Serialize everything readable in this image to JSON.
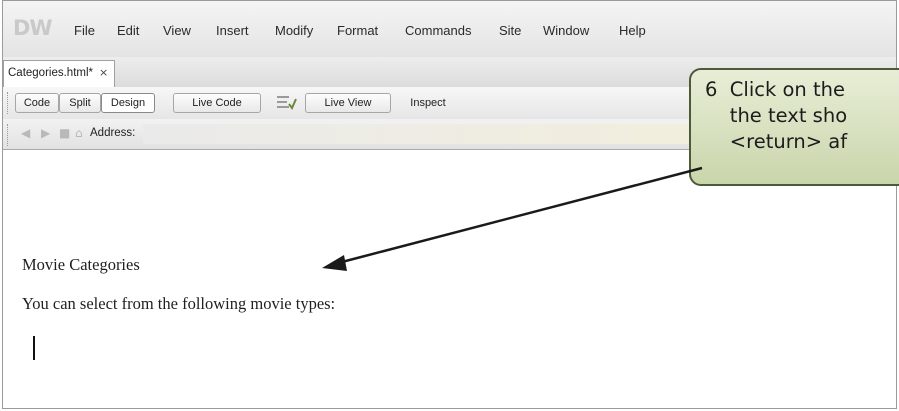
{
  "window": {
    "logo_text": "DW",
    "menu": [
      "File",
      "Edit",
      "View",
      "Insert",
      "Modify",
      "Format",
      "Commands",
      "Site",
      "Window",
      "Help"
    ]
  },
  "tabs": [
    {
      "label": "Categories.html*",
      "close": "×"
    }
  ],
  "doc_toolbar": {
    "buttons": [
      "Code",
      "Split",
      "Design",
      "Live Code",
      "Live View",
      "Inspect"
    ],
    "active": "Design"
  },
  "address_bar": {
    "label": "Address:",
    "value": ""
  },
  "document": {
    "lines": [
      "Movie Categories",
      "You can select from the following movie types:"
    ]
  },
  "callout": {
    "lines": [
      "6  Click on the",
      "    the text sho",
      "    <return> af"
    ],
    "fill": "#d6dfbf",
    "border": "#4d5a37"
  }
}
